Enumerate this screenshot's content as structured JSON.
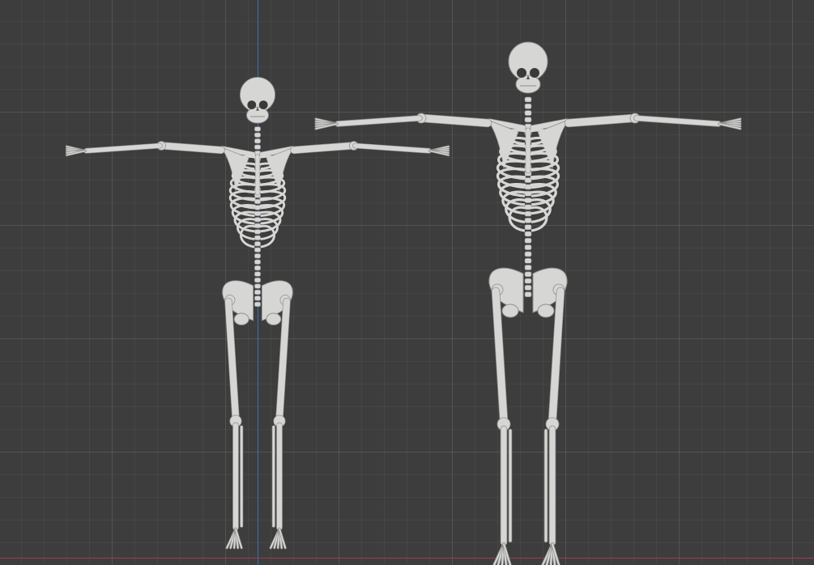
{
  "viewport": {
    "background_color": "#3d3d3d",
    "grid_color": "#4a4a4a",
    "axis_y_color": "#3e6fb5",
    "axis_x_color": "#a13c4a",
    "bone_color": "#d6d6d4",
    "bone_shadow_color": "#8f8f8d"
  },
  "objects": [
    {
      "icon": "skeleton-model-icon"
    },
    {
      "icon": "skeleton-model-icon"
    }
  ]
}
